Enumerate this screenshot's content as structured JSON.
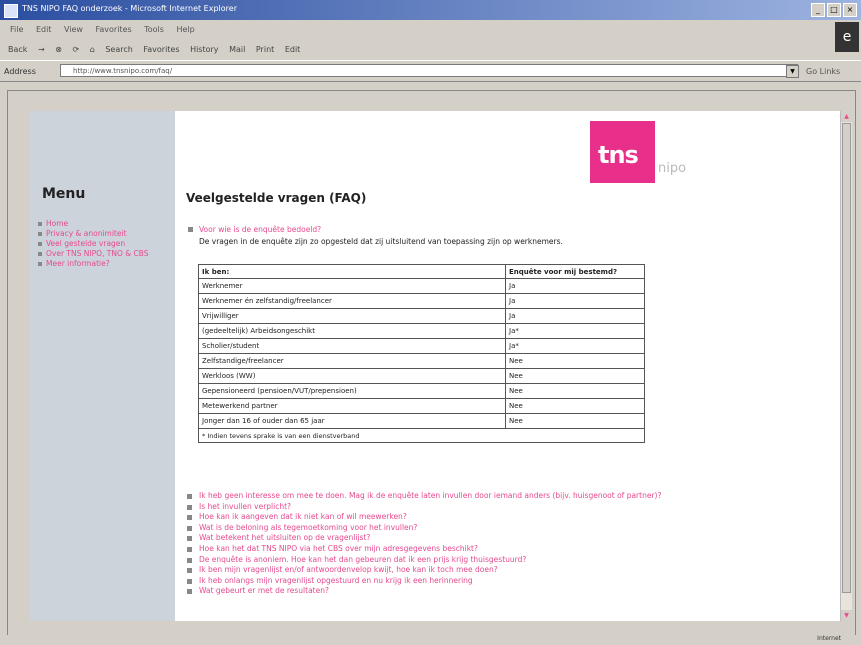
{
  "window": {
    "title": "TNS NIPO FAQ onderzoek - Microsoft Internet Explorer",
    "controls": [
      "_",
      "□",
      "×"
    ]
  },
  "menubar": [
    "File",
    "Edit",
    "View",
    "Favorites",
    "Tools",
    "Help"
  ],
  "toolbar": [
    "Back",
    "→",
    "⊗",
    "⟳",
    "⌂",
    "Search",
    "Favorites",
    "History",
    "Mail",
    "Print",
    "Edit"
  ],
  "address": {
    "label": "Address",
    "url": "http://www.tnsnipo.com/faq/",
    "go": "Go",
    "links": "Links"
  },
  "sidebar": {
    "title": "Menu",
    "items": [
      "Home",
      "Privacy & anonimiteit",
      "Veel gestelde vragen",
      "Over TNS NIPO, TNO & CBS",
      "Meer informatie?"
    ]
  },
  "logo": {
    "text": "tns",
    "suffix": "nipo"
  },
  "page_title": "Veelgestelde vragen (FAQ)",
  "first_question": {
    "question": "Voor wie is de enquête bedoeld?",
    "answer": "De vragen in de enquête zijn zo opgesteld dat zij uitsluitend van toepassing zijn op werknemers."
  },
  "table": {
    "headers": [
      "Ik ben:",
      "Enquête voor mij bestemd?"
    ],
    "rows": [
      [
        "Werknemer",
        "Ja"
      ],
      [
        "Werknemer én zelfstandig/freelancer",
        "Ja"
      ],
      [
        "Vrijwilliger",
        "Ja"
      ],
      [
        "(gedeeltelijk) Arbeidsongeschikt",
        "Ja*"
      ],
      [
        "Scholier/student",
        "Ja*"
      ],
      [
        "Zelfstandige/freelancer",
        "Nee"
      ],
      [
        "Werkloos (WW)",
        "Nee"
      ],
      [
        "Gepensioneerd (pensioen/VUT/prepensioen)",
        "Nee"
      ],
      [
        "Metewerkend partner",
        "Nee"
      ],
      [
        "Jonger dan 16 of ouder dan 65 jaar",
        "Nee"
      ]
    ],
    "note": "* Indien tevens sprake is van een dienstverband"
  },
  "questions": [
    "Ik heb geen interesse om mee te doen. Mag ik de enquête laten invullen door iemand anders (bijv. huisgenoot of partner)?",
    "Is het invullen verplicht?",
    "Hoe kan ik aangeven dat ik niet kan of wil meewerken?",
    "Wat is de beloning als tegemoetkoming voor het invullen?",
    "Wat betekent het uitsluiten op de vragenlijst?",
    "Hoe kan het dat TNS NIPO via het CBS over mijn adresgegevens beschikt?",
    "De enquête is anoniem. Hoe kan het dan gebeuren dat ik een prijs krijg thuisgestuurd?",
    "Ik ben mijn vragenlijst en/of antwoordenvelop kwijt, hoe kan ik toch mee doen?",
    "Ik heb onlangs mijn vragenlijst opgestuurd en nu krijg ik een herinnering",
    "Wat gebeurt er met de resultaten?"
  ],
  "status": {
    "zone": "Internet"
  }
}
